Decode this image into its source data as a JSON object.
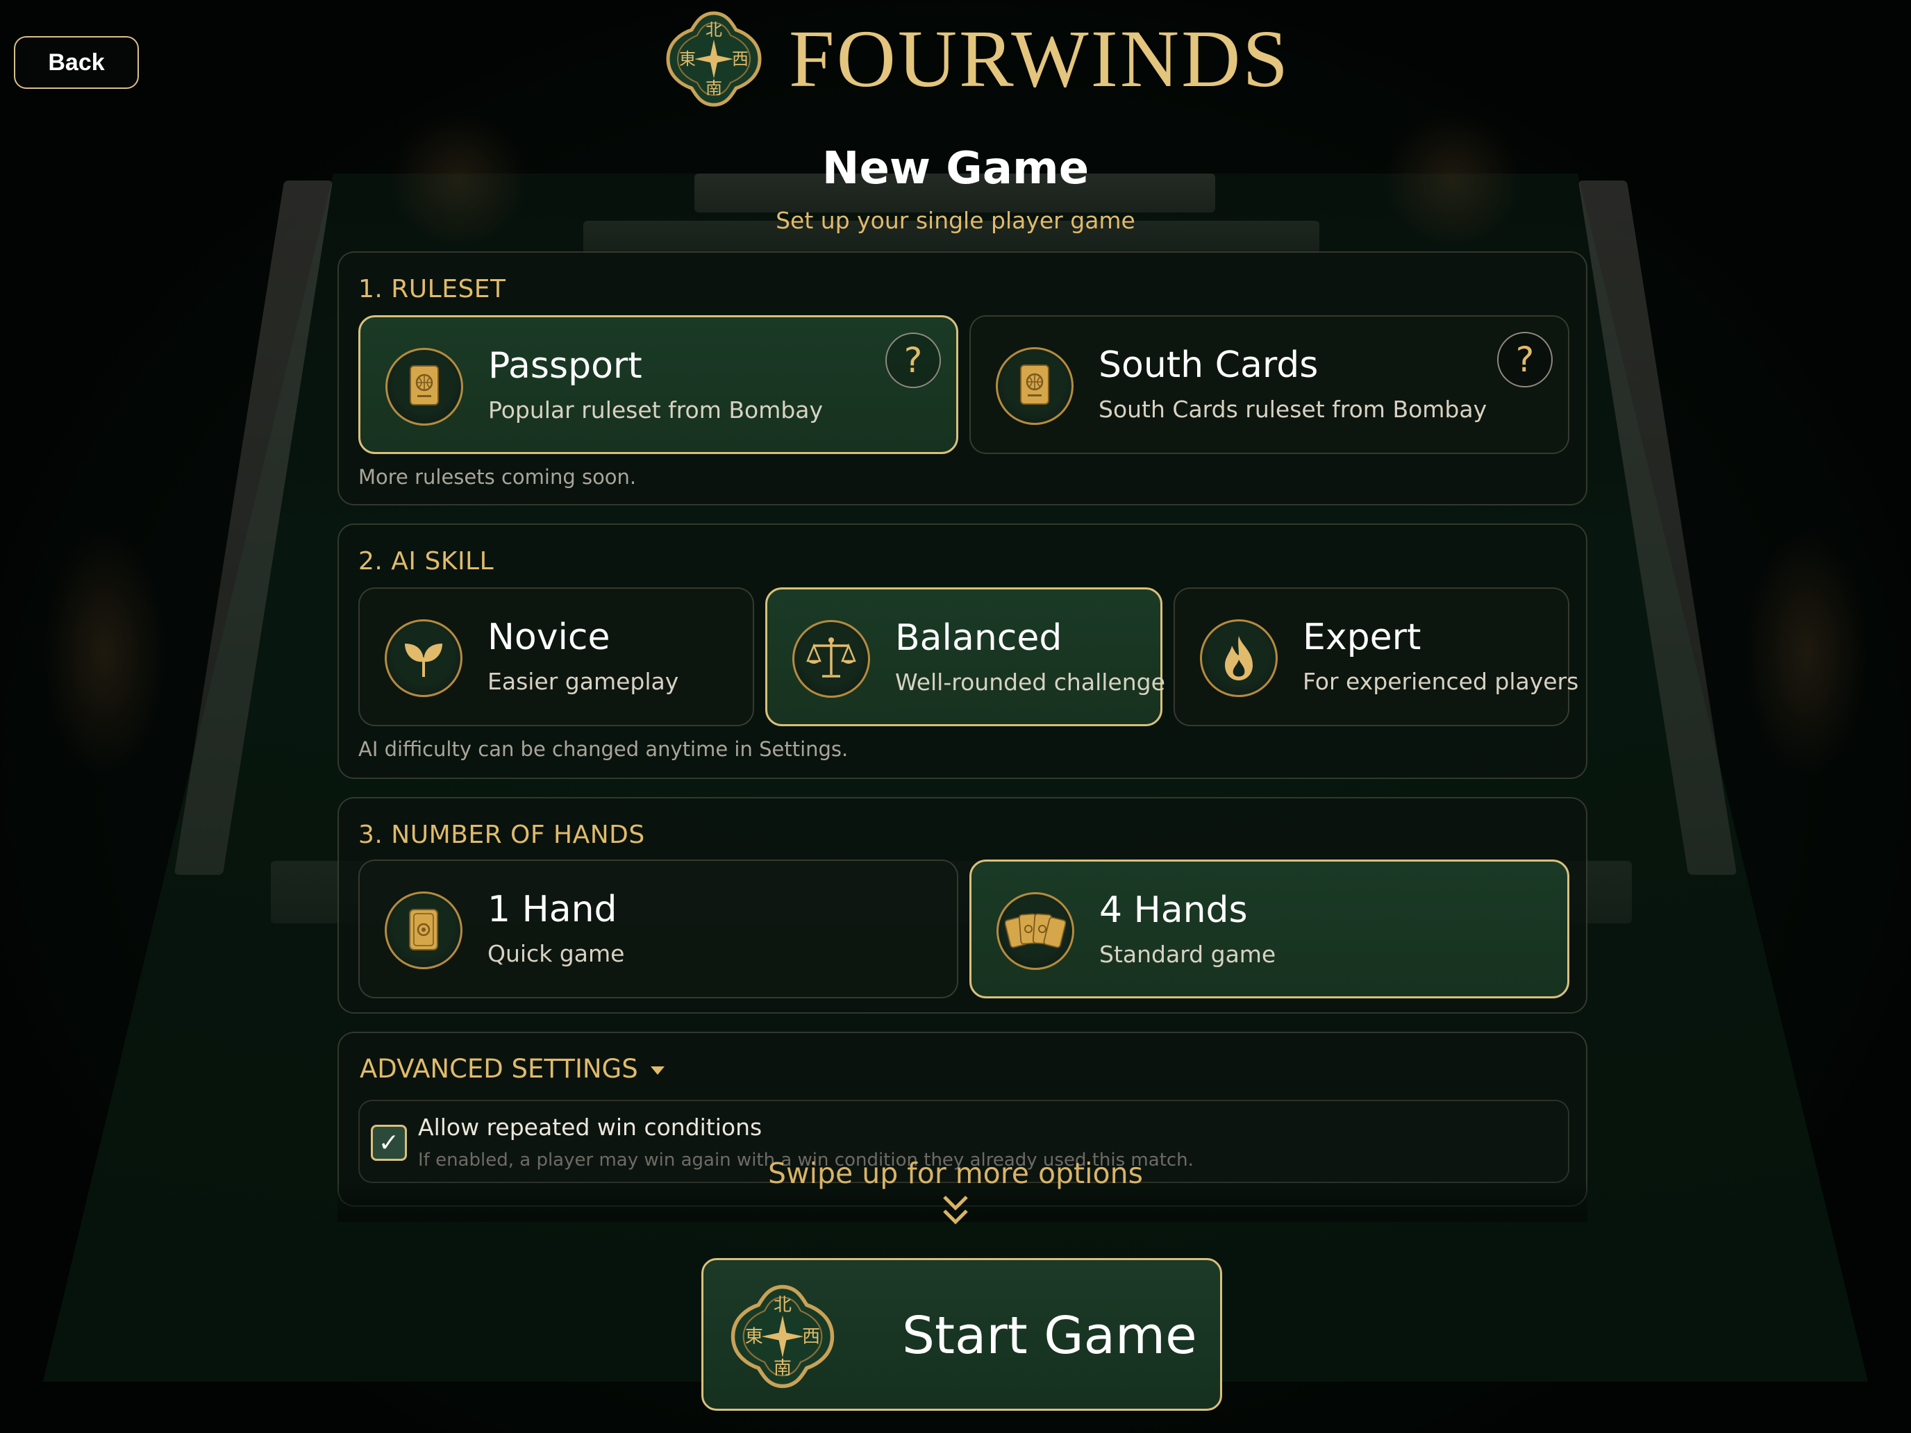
{
  "header": {
    "back_label": "Back",
    "brand": "FOURWINDS",
    "emblem_glyphs": {
      "north": "北",
      "east": "東",
      "west": "西",
      "south": "南"
    },
    "title": "New Game",
    "subtitle": "Set up your single player game"
  },
  "ruleset": {
    "heading": "1. RULESET",
    "note": "More rulesets coming soon.",
    "options": [
      {
        "title": "Passport",
        "desc": "Popular ruleset from Bombay",
        "icon": "passport-icon",
        "selected": true,
        "help": "?"
      },
      {
        "title": "South Cards",
        "desc": "South Cards ruleset from Bombay",
        "icon": "passport-icon",
        "selected": false,
        "help": "?"
      }
    ]
  },
  "ai_skill": {
    "heading": "2. AI SKILL",
    "note": "AI difficulty can be changed anytime in Settings.",
    "options": [
      {
        "title": "Novice",
        "desc": "Easier gameplay",
        "icon": "sprout-icon",
        "selected": false
      },
      {
        "title": "Balanced",
        "desc": "Well-rounded challenge",
        "icon": "scales-icon",
        "selected": true
      },
      {
        "title": "Expert",
        "desc": "For experienced players",
        "icon": "flame-icon",
        "selected": false
      }
    ]
  },
  "hands": {
    "heading": "3. NUMBER OF HANDS",
    "options": [
      {
        "title": "1 Hand",
        "desc": "Quick game",
        "icon": "single-tile-icon",
        "selected": false
      },
      {
        "title": "4 Hands",
        "desc": "Standard game",
        "icon": "fanned-tiles-icon",
        "selected": true
      }
    ]
  },
  "advanced": {
    "heading": "ADVANCED SETTINGS",
    "option_label": "Allow repeated win conditions",
    "option_desc": "If enabled, a player may win again with a win condition they already used this match.",
    "checked": true,
    "check_glyph": "✓"
  },
  "swipe_hint": "Swipe up for more options",
  "start_label": "Start Game",
  "colors": {
    "gold": "#e1bb6b",
    "selected_border": "#d9c07c",
    "selected_bg": "#1a3a26",
    "panel_bg": "#0a120d"
  }
}
